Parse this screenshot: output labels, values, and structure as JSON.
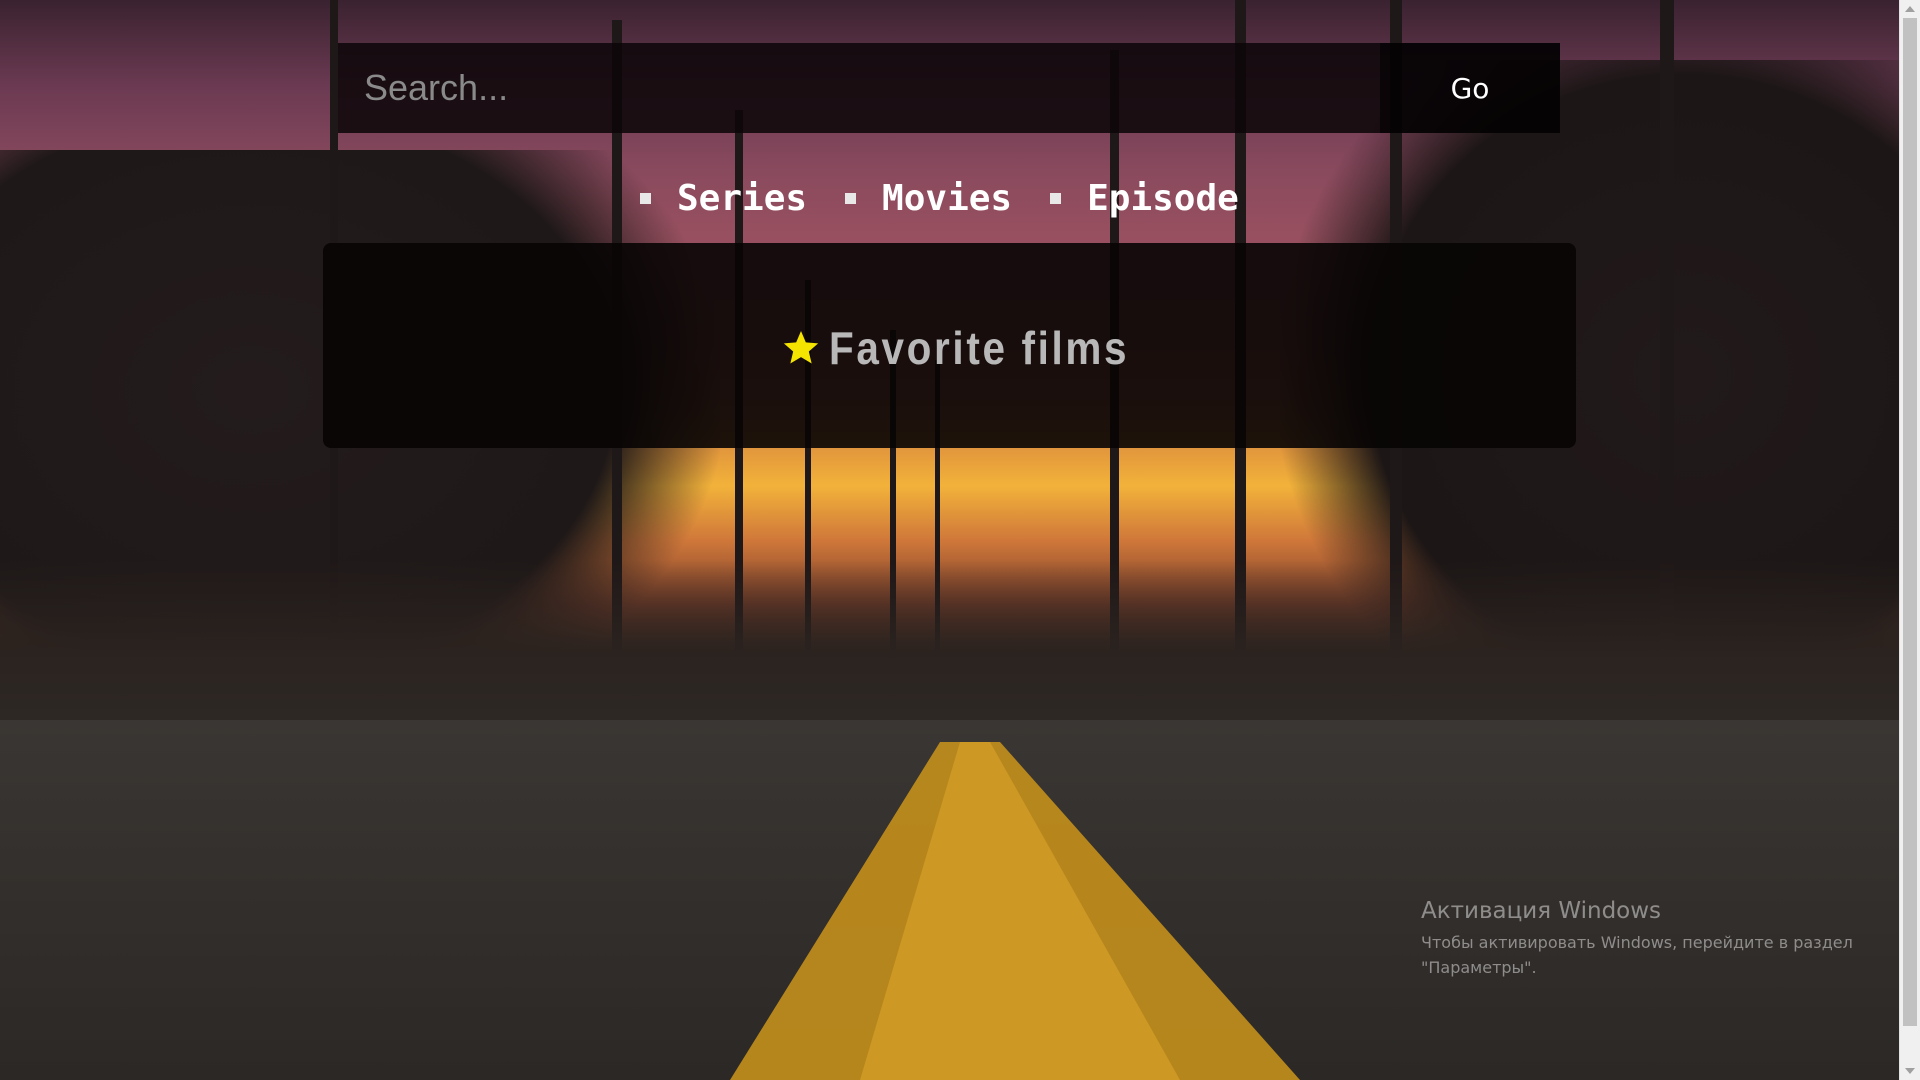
{
  "search": {
    "placeholder": "Search...",
    "value": "",
    "go_label": "Go"
  },
  "nav": {
    "items": [
      {
        "label": "Series"
      },
      {
        "label": "Movies"
      },
      {
        "label": "Episode"
      }
    ]
  },
  "favorites": {
    "title": "Favorite films",
    "icon": "star-icon",
    "icon_color": "#f5e400"
  },
  "watermark": {
    "title": "Активация Windows",
    "text": "Чтобы активировать Windows, перейдите в раздел \"Параметры\"."
  },
  "colors": {
    "panel_bg": "#0a0406",
    "accent_star": "#f5e400",
    "road_line": "#d49a1c"
  }
}
